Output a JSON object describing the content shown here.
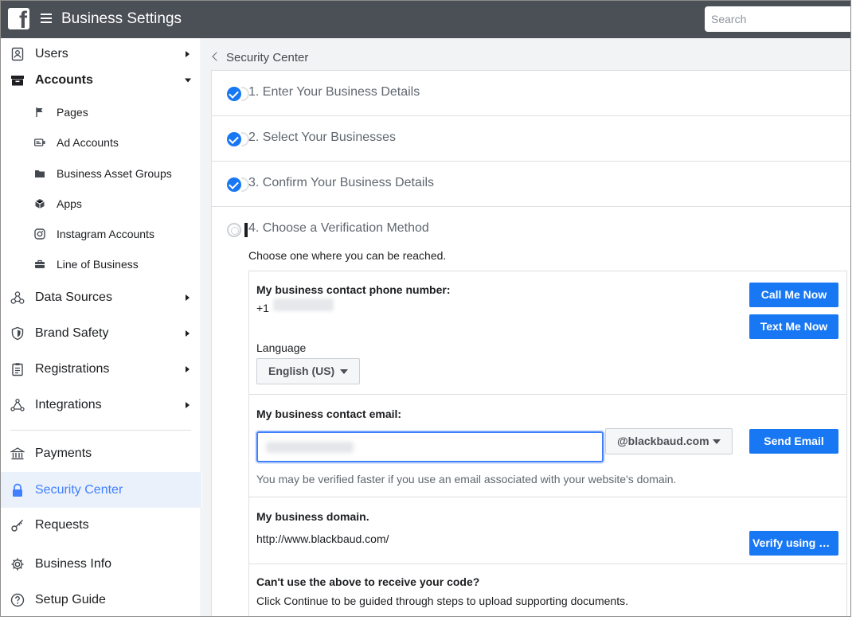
{
  "header": {
    "logo_letter": "f",
    "title": "Business Settings",
    "search_placeholder": "Search"
  },
  "sidebar": {
    "users": "Users",
    "accounts": "Accounts",
    "accounts_sub": {
      "pages": "Pages",
      "ad_accounts": "Ad Accounts",
      "business_asset_groups": "Business Asset Groups",
      "apps": "Apps",
      "instagram_accounts": "Instagram Accounts",
      "line_of_business": "Line of Business"
    },
    "data_sources": "Data Sources",
    "brand_safety": "Brand Safety",
    "registrations": "Registrations",
    "integrations": "Integrations",
    "payments": "Payments",
    "security_center": "Security Center",
    "requests": "Requests",
    "business_info": "Business Info",
    "setup_guide": "Setup Guide",
    "accent_color": "#4080ff"
  },
  "breadcrumb": {
    "label": "Security Center"
  },
  "steps": [
    {
      "label": "1. Enter Your Business Details",
      "status": "complete"
    },
    {
      "label": "2. Select Your Businesses",
      "status": "complete"
    },
    {
      "label": "3. Confirm Your Business Details",
      "status": "complete"
    },
    {
      "label": "4. Choose a Verification Method",
      "status": "current"
    }
  ],
  "verification": {
    "intro": "Choose one where you can be reached.",
    "phone": {
      "heading": "My business contact phone number:",
      "country_code": "+1",
      "call_button": "Call Me Now",
      "text_button": "Text Me Now",
      "language_label": "Language",
      "language_value": "English (US)"
    },
    "email": {
      "heading": "My business contact email:",
      "domain_value": "@blackbaud.com",
      "send_button": "Send Email",
      "note": "You may be verified faster if you use an email associated with your website's domain."
    },
    "domain": {
      "heading": "My business domain.",
      "url": "http://www.blackbaud.com/",
      "verify_button": "Verify using yo..."
    },
    "fallback": {
      "heading": "Can't use the above to receive your code?",
      "text": "Click Continue to be guided through steps to upload supporting documents."
    }
  },
  "colors": {
    "topbar": "#4b4f56",
    "primary_button": "#1877f2",
    "check": "#1877f2"
  }
}
